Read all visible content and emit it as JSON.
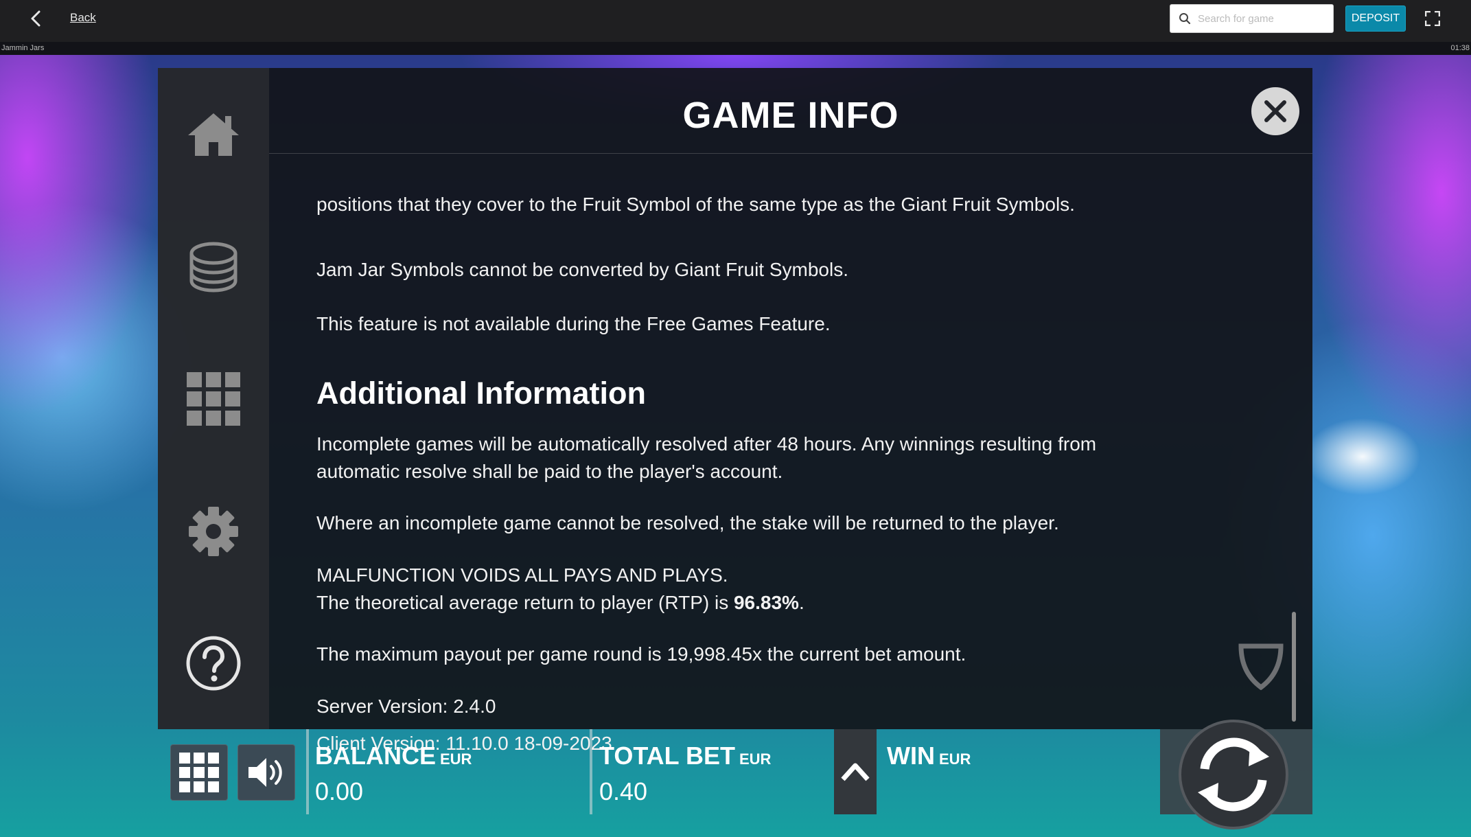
{
  "topbar": {
    "back_label": "Back",
    "search_placeholder": "Search for game",
    "deposit_label": "DEPOSIT"
  },
  "subbar": {
    "game_name": "Jammin Jars",
    "clock": "01:38"
  },
  "panel": {
    "title": "GAME INFO",
    "paragraphs": {
      "p1": "positions that they cover to the Fruit Symbol of the same type as the Giant Fruit Symbols.",
      "p2": "Jam Jar Symbols cannot be converted by Giant Fruit Symbols.",
      "p3": "This feature is not available during the Free Games Feature.",
      "heading": "Additional Information",
      "p4_line1": "Incomplete games will be automatically resolved after 48 hours. Any winnings resulting from",
      "p4_line2": "automatic resolve shall be paid to the player's account.",
      "p5": "Where an incomplete game cannot be resolved, the stake will be returned to the player.",
      "p6": "MALFUNCTION VOIDS ALL PAYS AND PLAYS.",
      "p7_prefix": "The theoretical average return to player (RTP) is ",
      "p7_rtp": "96.83%",
      "p7_suffix": ".",
      "p8": "The maximum payout per game round is 19,998.45x the current bet amount.",
      "p9": "Server Version: 2.4.0",
      "p10": "Client Version: 11.10.0 18-09-2023"
    },
    "side_menu": [
      "home-icon",
      "coins-icon",
      "grid-icon",
      "gear-icon",
      "help-icon"
    ]
  },
  "bottombar": {
    "balance_label": "BALANCE",
    "balance_currency": "EUR",
    "balance_value": "0.00",
    "totalbet_label": "TOTAL BET",
    "totalbet_currency": "EUR",
    "totalbet_value": "0.40",
    "win_label": "WIN",
    "win_currency": "EUR"
  },
  "colors": {
    "deposit": "#0b89a9",
    "panel_bg": "#12141a",
    "side_menu_bg": "#282a30"
  }
}
